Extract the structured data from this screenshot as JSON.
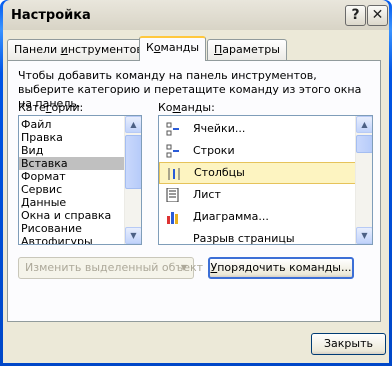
{
  "window": {
    "title": "Настройка"
  },
  "titlebar": {
    "help_label": "?",
    "close_label": "✕"
  },
  "tabs": [
    {
      "label": "Панели инструментов",
      "underline": "и",
      "prefix": "Панели ",
      "suffix": "нструментов",
      "active": false
    },
    {
      "label": "Команды",
      "underline": "о",
      "prefix": "К",
      "suffix": "манды",
      "active": true
    },
    {
      "label": "Параметры",
      "underline": "П",
      "prefix": "",
      "suffix": "араметры",
      "active": false
    }
  ],
  "description": "Чтобы добавить команду на панель инструментов, выберите категорию и перетащите команду из этого окна на панель.",
  "categories": {
    "label_prefix": "Кате",
    "label_u": "г",
    "label_suffix": "ории:",
    "items": [
      "Файл",
      "Правка",
      "Вид",
      "Вставка",
      "Формат",
      "Сервис",
      "Данные",
      "Окна и справка",
      "Рисование",
      "Автофигуры"
    ],
    "selected": "Вставка"
  },
  "commands": {
    "label_prefix": "Ко",
    "label_u": "м",
    "label_suffix": "анды:",
    "items": [
      {
        "label": "Ячейки...",
        "icon": "insert-cells-icon"
      },
      {
        "label": "Строки",
        "icon": "insert-rows-icon"
      },
      {
        "label": "Столбцы",
        "icon": "insert-columns-icon",
        "selected": true
      },
      {
        "label": "Лист",
        "icon": "insert-sheet-icon"
      },
      {
        "label": "Диаграмма...",
        "icon": "insert-chart-icon"
      },
      {
        "label": "Разрыв страницы",
        "icon": "page-break-icon"
      }
    ]
  },
  "buttons": {
    "modify_selection": "Изменить выделенный объект",
    "rearrange_prefix": "",
    "rearrange_u": "У",
    "rearrange_suffix": "порядочить команды...",
    "close": "Закрыть"
  },
  "colors": {
    "accent_tab": "#ffc83c",
    "selection": "#fdf4c1",
    "xp_blue": "#0055e5"
  }
}
